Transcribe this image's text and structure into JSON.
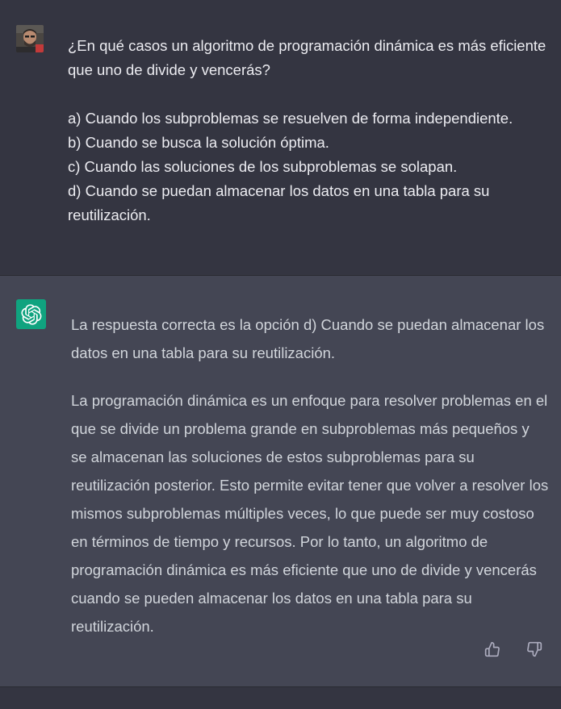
{
  "user_message": {
    "avatar_icon": "user-avatar-photo",
    "text": "¿En qué casos un algoritmo de programación dinámica es más eficiente que uno de divide y vencerás?\n\na) Cuando los subproblemas se resuelven de forma independiente.\nb) Cuando se busca la solución óptima.\nc) Cuando las soluciones de los subproblemas se solapan.\nd) Cuando se puedan almacenar los datos en una tabla para su reutilización."
  },
  "assistant_message": {
    "avatar_icon": "openai-logo-icon",
    "paragraphs": [
      "La respuesta correcta es la opción d) Cuando se puedan almacenar los datos en una tabla para su reutilización.",
      "La programación dinámica es un enfoque para resolver problemas en el que se divide un problema grande en subproblemas más pequeños y se almacenan las soluciones de estos subproblemas para su reutilización posterior. Esto permite evitar tener que volver a resolver los mismos subproblemas múltiples veces, lo que puede ser muy costoso en términos de tiempo y recursos. Por lo tanto, un algoritmo de programación dinámica es más eficiente que uno de divide y vencerás cuando se pueden almacenar los datos en una tabla para su reutilización."
    ],
    "feedback_icons": [
      "thumbs-up-icon",
      "thumbs-down-icon"
    ]
  },
  "colors": {
    "user_bg": "#343541",
    "assistant_bg": "#444654",
    "brand_green": "#10a37f",
    "user_text": "#ececf1",
    "assistant_text": "#d1d5db"
  }
}
